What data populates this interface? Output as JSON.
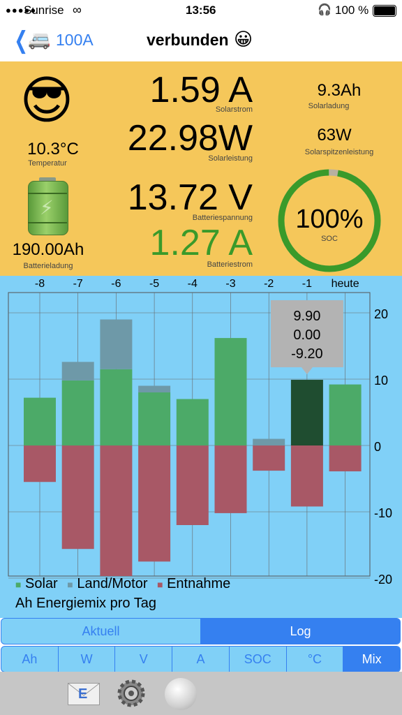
{
  "status": {
    "carrier": "Sunrise",
    "time": "13:56",
    "battery": "100 %"
  },
  "nav": {
    "device": "100A",
    "title": "verbunden",
    "status_emoji": "😀",
    "vehicle_emoji": "🚐"
  },
  "info": {
    "temp_emoji": "😎",
    "temperature": "10.3°C",
    "temperature_label": "Temperatur",
    "battery_capacity": "190.00Ah",
    "battery_capacity_label": "Batterieladung",
    "solar_current": "1.59 A",
    "solar_current_label": "Solarstrom",
    "solar_power": "22.98W",
    "solar_power_label": "Solarleistung",
    "battery_voltage": "13.72 V",
    "battery_voltage_label": "Batteriespannung",
    "battery_current": "1.27 A",
    "battery_current_label": "Batteriestrom",
    "solar_charge": "9.3Ah",
    "solar_charge_label": "Solarladung",
    "solar_peak": "63W",
    "solar_peak_label": "Solarspitzenleistung",
    "soc": "100%",
    "soc_label": "SOC",
    "soc_fraction": 1.0,
    "colors": {
      "panel": "#f5c75a",
      "green": "#3a9a2a",
      "ring": "#3a9a2a"
    }
  },
  "chart_data": {
    "type": "bar",
    "categories": [
      "-8",
      "-7",
      "-6",
      "-5",
      "-4",
      "-3",
      "-2",
      "-1",
      "heute"
    ],
    "series": [
      {
        "name": "Solar",
        "values": [
          7.2,
          9.8,
          11.5,
          8.0,
          7.0,
          16.2,
          0,
          9.9,
          9.2
        ],
        "color": "#4caa68"
      },
      {
        "name": "Land/Motor",
        "values": [
          0,
          2.8,
          7.5,
          1.0,
          0,
          0,
          1.0,
          0.0,
          0
        ],
        "color": "#6e99a8"
      },
      {
        "name": "Entnahme",
        "values": [
          -5.5,
          -15.6,
          -20.5,
          -17.5,
          -12.0,
          -10.2,
          -3.8,
          -9.2,
          -3.9
        ],
        "color": "#a85866"
      }
    ],
    "yticks": [
      "20",
      "10",
      "0",
      "-10",
      "-20"
    ],
    "ylim": [
      -22,
      22
    ],
    "highlight_index": 7,
    "tooltip": [
      "9.90",
      "0.00",
      "-9.20"
    ],
    "title": "Ah Energiemix pro Tag"
  },
  "tabs": {
    "items": [
      "Aktuell",
      "Log"
    ],
    "selected": 1
  },
  "metric_tabs": {
    "items": [
      "Ah",
      "W",
      "V",
      "A",
      "SOC",
      "°C",
      "Mix"
    ],
    "selected": 6
  }
}
